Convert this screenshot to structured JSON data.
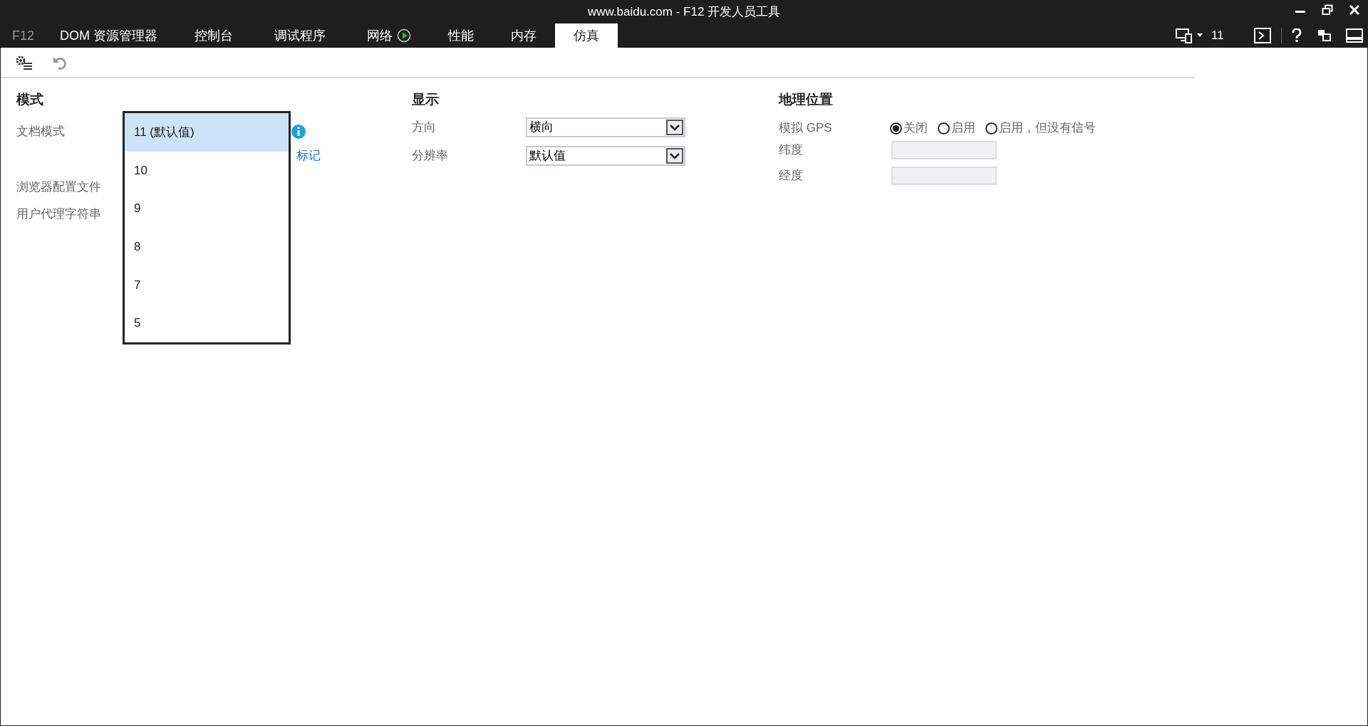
{
  "window": {
    "title": "www.baidu.com - F12 开发人员工具"
  },
  "app_label": "F12",
  "tabs": [
    {
      "label": "DOM 资源管理器",
      "selected": false
    },
    {
      "label": "控制台",
      "selected": false
    },
    {
      "label": "调试程序",
      "selected": false
    },
    {
      "label": "网络",
      "selected": false,
      "recording": true
    },
    {
      "label": "性能",
      "selected": false
    },
    {
      "label": "内存",
      "selected": false
    },
    {
      "label": "仿真",
      "selected": true
    }
  ],
  "document_mode_indicator": "11",
  "mode": {
    "heading": "模式",
    "document_mode_label": "文档模式",
    "link": "标记",
    "browser_profile_label": "浏览器配置文件",
    "user_agent_label": "用户代理字符串",
    "dropdown": [
      {
        "label": "11 (默认值)",
        "selected": true
      },
      {
        "label": "10",
        "selected": false
      },
      {
        "label": "9",
        "selected": false
      },
      {
        "label": "8",
        "selected": false
      },
      {
        "label": "7",
        "selected": false
      },
      {
        "label": "5",
        "selected": false
      }
    ]
  },
  "display": {
    "heading": "显示",
    "fields": [
      {
        "label": "方向",
        "value": "横向"
      },
      {
        "label": "分辨率",
        "value": "默认值"
      }
    ]
  },
  "geolocation": {
    "heading": "地理位置",
    "gps_label": "模拟 GPS",
    "gps_options": [
      {
        "label": "关闭",
        "selected": true
      },
      {
        "label": "启用",
        "selected": false
      },
      {
        "label": "启用，但没有信号",
        "selected": false
      }
    ],
    "fields": [
      {
        "label": "纬度"
      },
      {
        "label": "经度"
      }
    ]
  }
}
